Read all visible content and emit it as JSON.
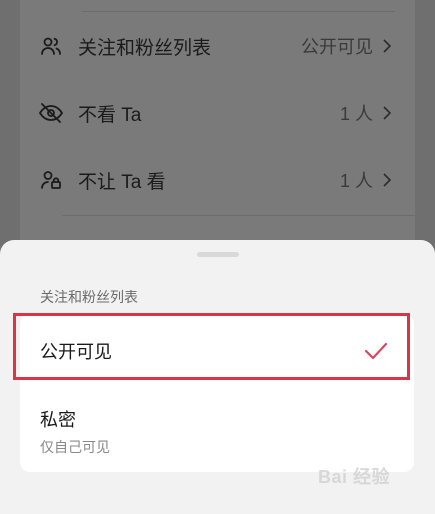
{
  "background_settings": {
    "rows": [
      {
        "label": "关注和粉丝列表",
        "value": "公开可见",
        "icon": "users-icon"
      },
      {
        "label": "不看 Ta",
        "value": "1 人",
        "icon": "eye-off-icon"
      },
      {
        "label": "不让 Ta 看",
        "value": "1 人",
        "icon": "user-lock-icon"
      }
    ]
  },
  "sheet": {
    "title": "关注和粉丝列表",
    "options": [
      {
        "label": "公开可见",
        "selected": true
      },
      {
        "label": "私密",
        "description": "仅自己可见",
        "selected": false
      }
    ],
    "accent_color": "#e0445f"
  },
  "annotation": {
    "highlight_color": "#d93545"
  },
  "watermark": {
    "text": "Bai 经验"
  }
}
